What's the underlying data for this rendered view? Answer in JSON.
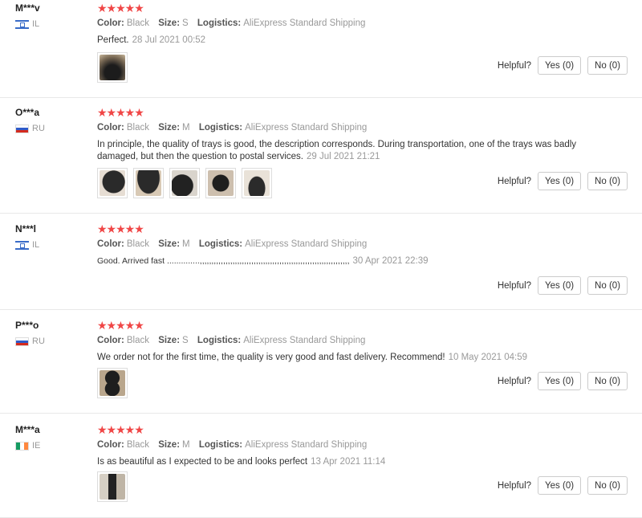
{
  "labels": {
    "color": "Color:",
    "size": "Size:",
    "logistics": "Logistics:",
    "helpful": "Helpful?",
    "yes": "Yes (0)",
    "no": "No (0)",
    "stars": "★★★★★"
  },
  "reviews": [
    {
      "user": "M***v",
      "country": "IL",
      "color": "Black",
      "size": "S",
      "logistics": "AliExpress Standard Shipping",
      "text": "Perfect.",
      "date": "28 Jul 2021 00:52"
    },
    {
      "user": "O***a",
      "country": "RU",
      "color": "Black",
      "size": "M",
      "logistics": "AliExpress Standard Shipping",
      "text": "In principle, the quality of trays is good, the description corresponds. During transportation, one of the trays was badly damaged, but then the question to postal services.",
      "date": "29 Jul 2021 21:21"
    },
    {
      "user": "N***l",
      "country": "IL",
      "color": "Black",
      "size": "M",
      "logistics": "AliExpress Standard Shipping",
      "text": "Good. Arrived fast ..............,,,,,,,,,,,,,,,,,,,,,,,,,,,,,,,,,,,,,,,,,,,,,,,,,,,,,,,,,,,,,,,,",
      "date": "30 Apr 2021 22:39"
    },
    {
      "user": "P***o",
      "country": "RU",
      "color": "Black",
      "size": "S",
      "logistics": "AliExpress Standard Shipping",
      "text": "We order not for the first time, the quality is very good and fast delivery. Recommend!",
      "date": "10 May 2021 04:59"
    },
    {
      "user": "M***a",
      "country": "IE",
      "color": "Black",
      "size": "M",
      "logistics": "AliExpress Standard Shipping",
      "text": "Is as beautiful as I expected to be and looks perfect",
      "date": "13 Apr 2021 11:14"
    }
  ]
}
